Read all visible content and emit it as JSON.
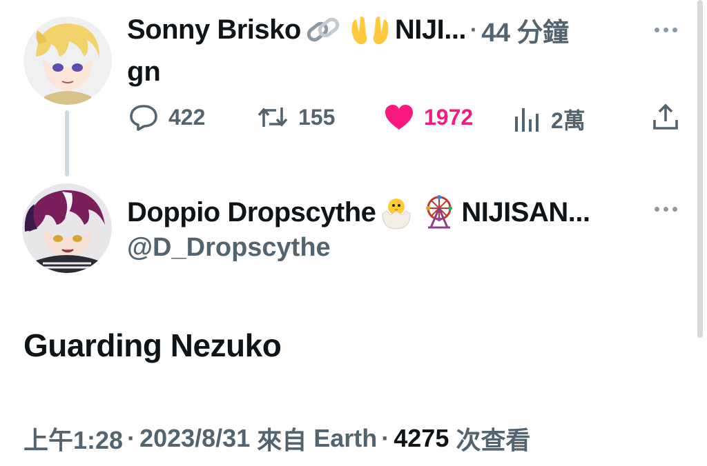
{
  "reply_tweet": {
    "author_name": "Sonny Brisko",
    "author_suffix": "NIJI...",
    "time_ago": "44 分鐘",
    "text": "gn",
    "actions": {
      "replies": "422",
      "retweets": "155",
      "likes": "1972",
      "views": "2萬"
    }
  },
  "main_tweet": {
    "author_name": "Doppio Dropscythe",
    "author_suffix": "NIJISAN...",
    "handle": "@D_Dropscythe",
    "text": "Guarding Nezuko",
    "time": "上午1:28",
    "date": "2023/8/31",
    "source_prefix": "來自",
    "source": "Earth",
    "views_count": "4275",
    "views_label": "次查看"
  },
  "colors": {
    "text": "#0f1419",
    "muted": "#536471",
    "like": "#f91880",
    "thread_line": "#cfd9de"
  }
}
